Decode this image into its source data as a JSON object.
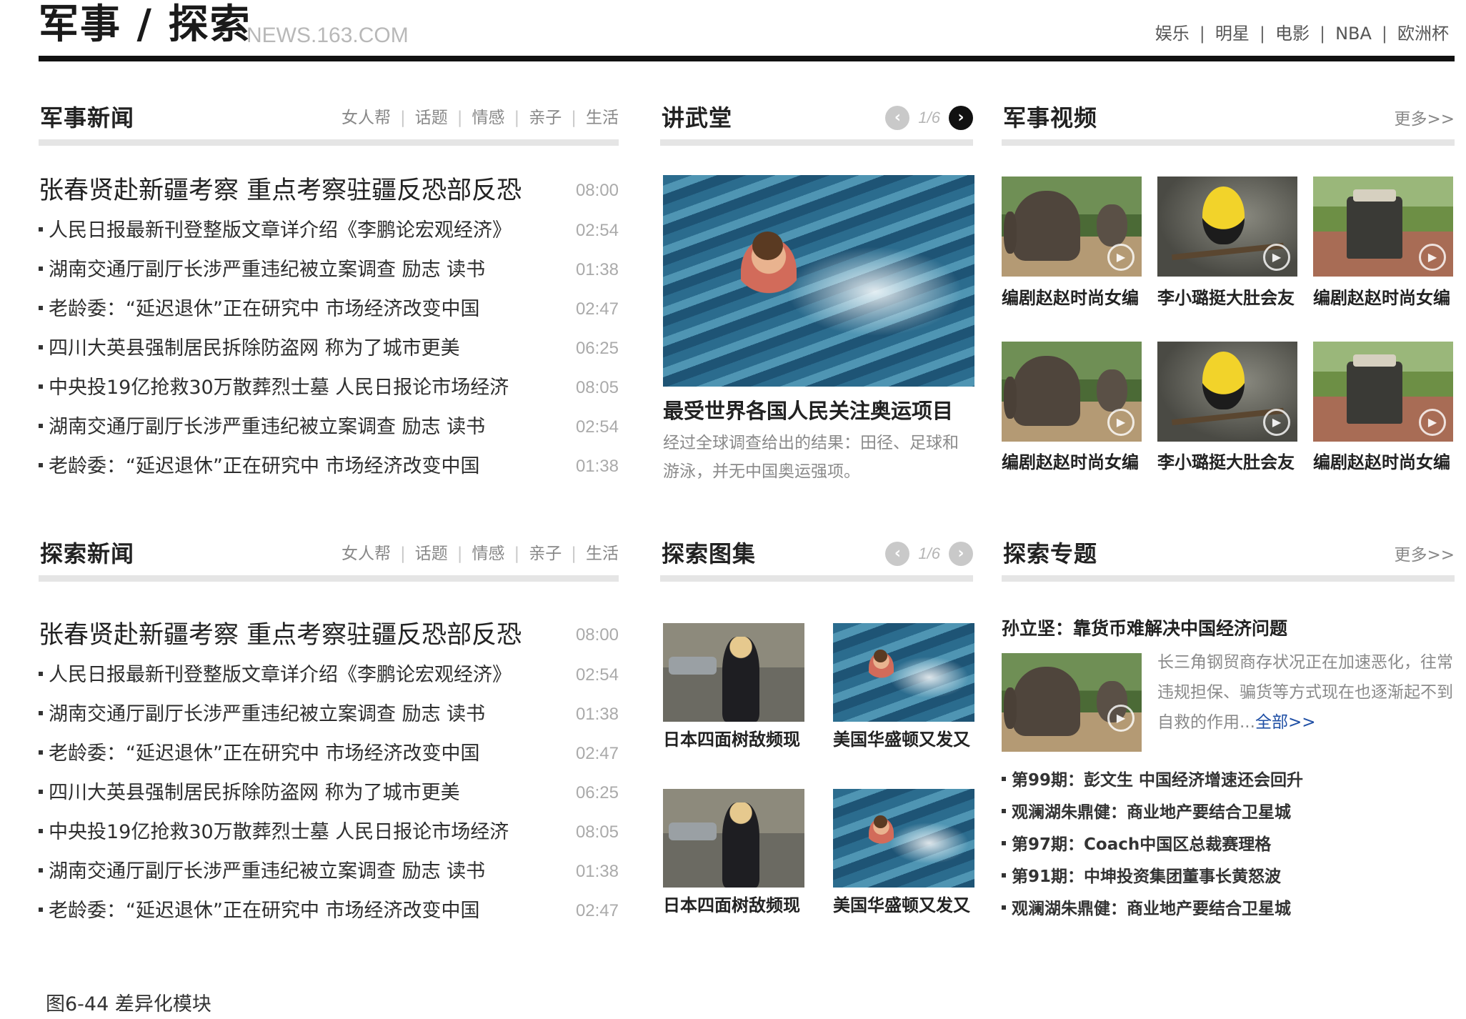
{
  "header": {
    "title": "军事 / 探索",
    "domain": "NEWS.163.COM",
    "nav": [
      "娱乐",
      "明星",
      "电影",
      "NBA",
      "欧洲杯"
    ]
  },
  "military_news": {
    "title": "军事新闻",
    "tabs": [
      "女人帮",
      "话题",
      "情感",
      "亲子",
      "生活"
    ],
    "lead": {
      "text": "张春贤赴新疆考察 重点考察驻疆反恐部反恐",
      "time": "08:00"
    },
    "items": [
      {
        "text": "人民日报最新刊登整版文章详介绍《李鹏论宏观经济》",
        "time": "02:54"
      },
      {
        "text": "湖南交通厅副厅长涉严重违纪被立案调查 励志 读书",
        "time": "01:38"
      },
      {
        "text": "老龄委：“延迟退休”正在研究中 市场经济改变中国",
        "time": "02:47"
      },
      {
        "text": "四川大英县强制居民拆除防盗网 称为了城市更美",
        "time": "06:25"
      },
      {
        "text": "中央投19亿抢救30万散葬烈士墓 人民日报论市场经济",
        "time": "08:05"
      },
      {
        "text": "湖南交通厅副厅长涉严重违纪被立案调查 励志 读书",
        "time": "02:54"
      },
      {
        "text": "老龄委：“延迟退休”正在研究中 市场经济改变中国",
        "time": "01:38"
      }
    ]
  },
  "lecture": {
    "title": "讲武堂",
    "page": "1/6",
    "feature_title": "最受世界各国人民关注奥运项目",
    "feature_desc": "经过全球调查给出的结果：田径、足球和游泳，并无中国奥运强项。"
  },
  "military_video": {
    "title": "军事视频",
    "more": "更多>>",
    "items": [
      {
        "caption": "编剧赵赵时尚女编",
        "image": "elephant"
      },
      {
        "caption": "李小璐挺大肚会友",
        "image": "bird"
      },
      {
        "caption": "编剧赵赵时尚女编",
        "image": "jeep"
      },
      {
        "caption": "编剧赵赵时尚女编",
        "image": "elephant"
      },
      {
        "caption": "李小璐挺大肚会友",
        "image": "bird"
      },
      {
        "caption": "编剧赵赵时尚女编",
        "image": "jeep"
      }
    ]
  },
  "explore_news": {
    "title": "探索新闻",
    "tabs": [
      "女人帮",
      "话题",
      "情感",
      "亲子",
      "生活"
    ],
    "lead": {
      "text": "张春贤赴新疆考察 重点考察驻疆反恐部反恐",
      "time": "08:00"
    },
    "items": [
      {
        "text": "人民日报最新刊登整版文章详介绍《李鹏论宏观经济》",
        "time": "02:54"
      },
      {
        "text": "湖南交通厅副厅长涉严重违纪被立案调查 励志 读书",
        "time": "01:38"
      },
      {
        "text": "老龄委：“延迟退休”正在研究中 市场经济改变中国",
        "time": "02:47"
      },
      {
        "text": "四川大英县强制居民拆除防盗网 称为了城市更美",
        "time": "06:25"
      },
      {
        "text": "中央投19亿抢救30万散葬烈士墓 人民日报论市场经济",
        "time": "08:05"
      },
      {
        "text": "湖南交通厅副厅长涉严重违纪被立案调查 励志 读书",
        "time": "01:38"
      },
      {
        "text": "老龄委：“延迟退休”正在研究中 市场经济改变中国",
        "time": "02:47"
      }
    ]
  },
  "explore_gallery": {
    "title": "探索图集",
    "page": "1/6",
    "items": [
      {
        "caption": "日本四面树敌频现",
        "image": "street"
      },
      {
        "caption": "美国华盛顿又发又",
        "image": "swimmer"
      },
      {
        "caption": "日本四面树敌频现",
        "image": "street"
      },
      {
        "caption": "美国华盛顿又发又",
        "image": "swimmer"
      }
    ]
  },
  "explore_topics": {
    "title": "探索专题",
    "more": "更多>>",
    "feature_title": "孙立坚：靠货币难解决中国经济问题",
    "feature_desc": "长三角钢贸商存状况正在加速恶化，往常违规担保、骗货等方式现在也逐渐起不到自救的作用...",
    "feature_link": "全部>>",
    "items": [
      "第99期：彭文生 中国经济增速还会回升",
      "观澜湖朱鼎健：商业地产要结合卫星城",
      "第97期：Coach中国区总裁赛理格",
      "第91期：中坤投资集团董事长黄怒波",
      "观澜湖朱鼎健：商业地产要结合卫星城"
    ]
  },
  "figure_caption": "图6-44 差异化模块"
}
